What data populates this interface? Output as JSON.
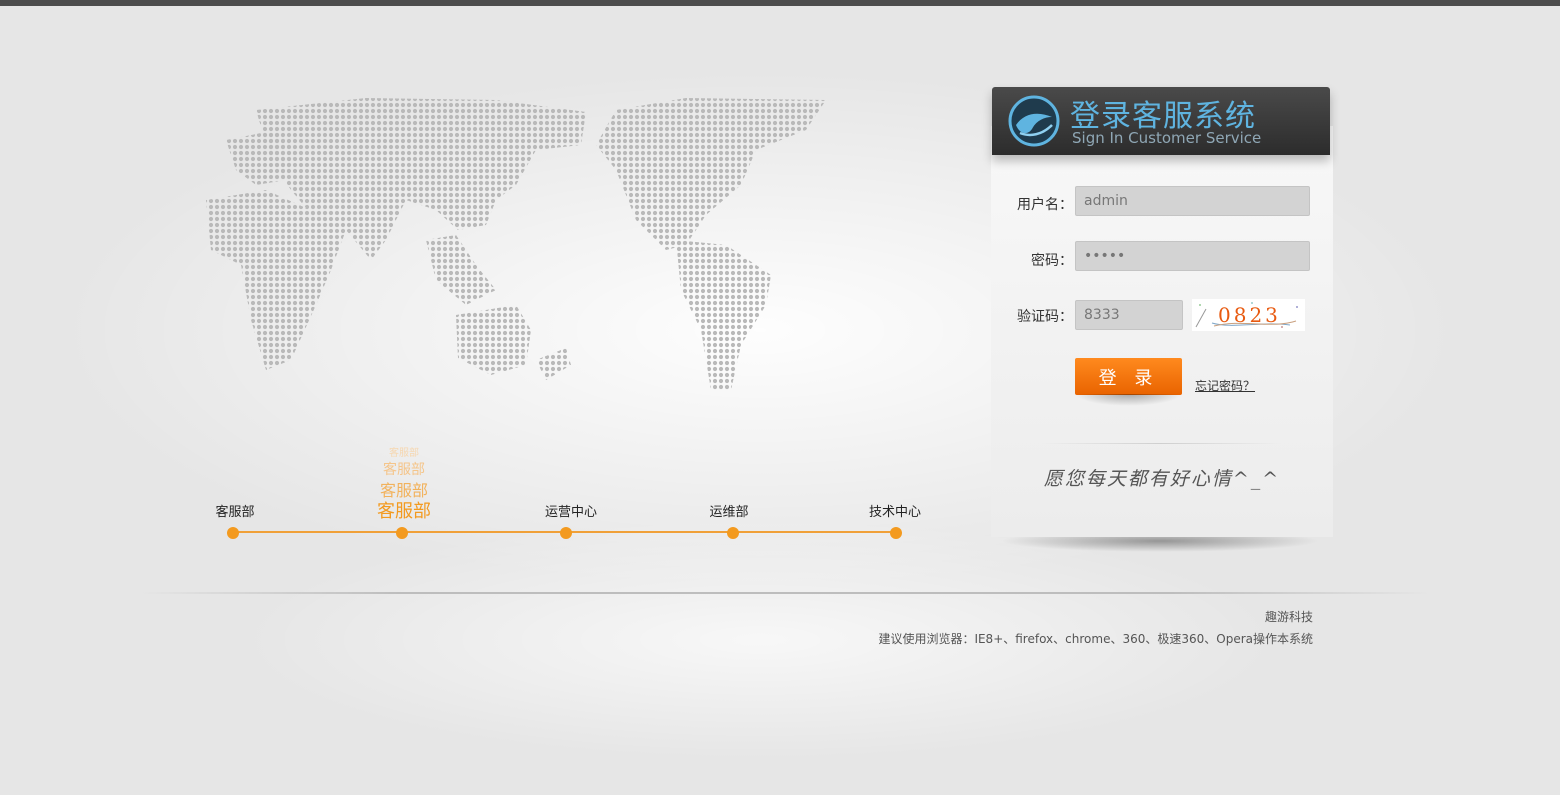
{
  "colors": {
    "accent": "#f39a1f",
    "header_blue": "#5fb4e0",
    "button": "#f07410"
  },
  "timeline": {
    "items": [
      {
        "label": "客服部"
      },
      {
        "label": "客服部"
      },
      {
        "label": "运营中心"
      },
      {
        "label": "运维部"
      },
      {
        "label": "技术中心"
      }
    ],
    "animation_text": "客服部"
  },
  "login": {
    "title": "登录客服系统",
    "subtitle": "Sign In Customer Service",
    "username_label": "用户名：",
    "username_value": "admin",
    "password_label": "密码：",
    "password_value": "•••••",
    "captcha_label": "验证码：",
    "captcha_value": "8333",
    "captcha_image_text": "0823",
    "login_button": "登 录",
    "forgot_password": "忘记密码？",
    "slogan": "愿您每天都有好心情^_^"
  },
  "footer": {
    "company": "趣游科技",
    "browsers": "建议使用浏览器：IE8+、firefox、chrome、360、极速360、Opera操作本系统"
  }
}
